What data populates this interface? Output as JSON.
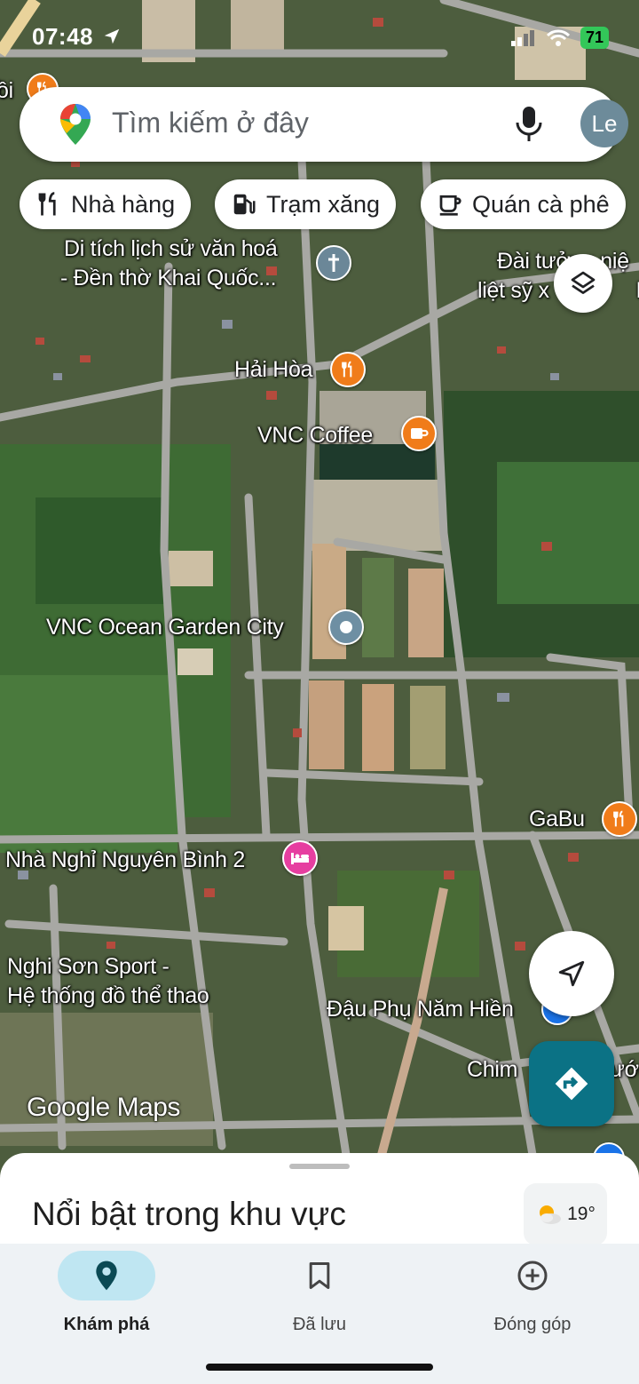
{
  "status": {
    "time": "07:48",
    "battery": "71"
  },
  "search": {
    "placeholder": "Tìm kiếm ở đây",
    "avatar_initials": "Le"
  },
  "chips": [
    {
      "label": "Nhà hàng",
      "icon": "restaurant-icon"
    },
    {
      "label": "Trạm xăng",
      "icon": "gas-station-icon"
    },
    {
      "label": "Quán cà phê",
      "icon": "coffee-icon"
    }
  ],
  "map_labels": {
    "relic_line1": "Di tích lịch sử văn hoá",
    "relic_line2": "- Đền thờ Khai Quốc...",
    "memorial_line1": "Đài tưởng niệ",
    "memorial_line2": "liệt sỹ x",
    "memorial_line2_tail": "H",
    "hai_hoa": "Hải Hòa",
    "vnc_coffee": "VNC Coffee",
    "ocean_garden": "VNC Ocean Garden City",
    "gabu": "GaBu",
    "guesthouse": "Nhà Nghỉ Nguyên Bình 2",
    "sport_line1": "Nghi Sơn Sport -",
    "sport_line2": "Hệ thống đồ thể thao",
    "tofu": "Đậu Phụ Năm Hiền",
    "chim": "Chim",
    "chim_tail": "ước",
    "left_edge": "ồi"
  },
  "map_brand": "Google Maps",
  "sheet": {
    "title": "Nổi bật trong khu vực",
    "weather": "19°"
  },
  "nav": {
    "explore": "Khám phá",
    "saved": "Đã lưu",
    "contribute": "Đóng góp"
  },
  "colors": {
    "active_pill": "#bfe6f2",
    "directions_button": "#0b7285",
    "food_pin": "#f07c1a",
    "hotel_pin": "#e63ea0"
  }
}
